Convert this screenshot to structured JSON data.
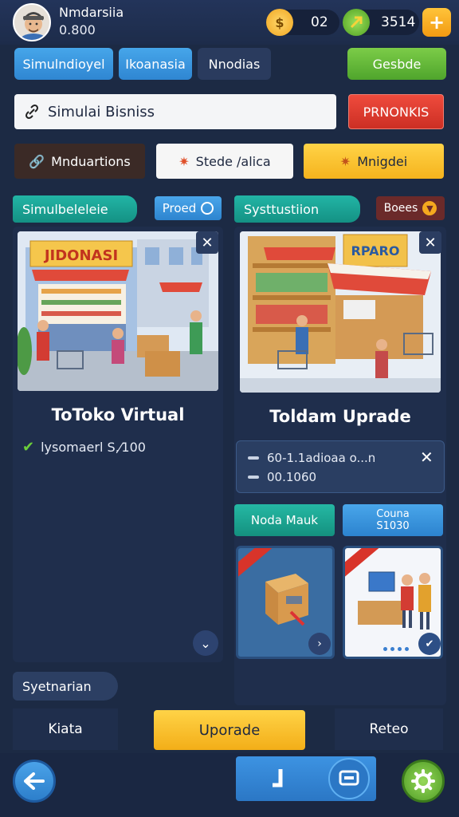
{
  "header": {
    "player_name": "Nmdarsiia",
    "player_score": "0.800",
    "coins": "02",
    "gems": "3514",
    "plus_label": "+"
  },
  "tabs": [
    {
      "label": "Simulndioyel"
    },
    {
      "label": "Ikoanasia"
    },
    {
      "label": "Nnodias"
    },
    {
      "label": "Gesbde"
    }
  ],
  "search": {
    "value": "Simulai Bisniss",
    "action_label": "PRNONKIS"
  },
  "filters": [
    {
      "label": "Mnduartions"
    },
    {
      "label": "Stede /alica"
    },
    {
      "label": "Mnigdei"
    }
  ],
  "left_panel": {
    "section_label": "Simulbeleleie",
    "badge_label": "Proed",
    "image_sign": "JIDONASI",
    "title": "ToToko Virtual",
    "check_text": "Iysomaeri S ⁄100",
    "check_display": "lysomaerl S,⁄100",
    "footer_label": "Syetnarian"
  },
  "right_panel": {
    "section_label": "Systtustiion",
    "badge_label": "Boees",
    "image_sign": "RPARO",
    "title": "Toldam Uprade",
    "info_line1": "60-1.1adioaa o...n",
    "info_line2": "00.1060",
    "mini_btn1": "Noda Mauk",
    "mini_btn2_line1": "Couna",
    "mini_btn2_line2": "S1030"
  },
  "bottom": {
    "left_label": "Kiata",
    "center_label": "Uporade",
    "right_label": "Reteo"
  },
  "colors": {
    "background": "#1c2a44",
    "accent_blue": "#3b93e0",
    "accent_green": "#5fb636",
    "accent_yellow": "#ffc52f",
    "accent_red": "#e03b30",
    "teal": "#1aa596"
  }
}
